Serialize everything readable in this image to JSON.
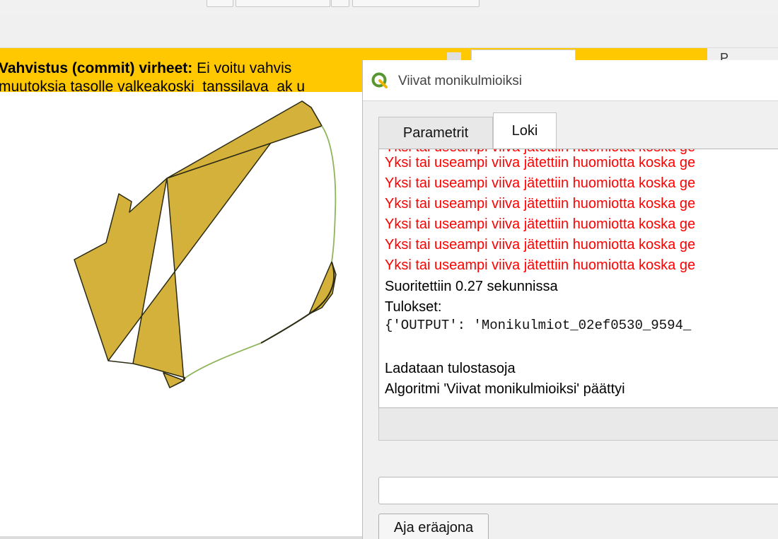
{
  "message_bar": {
    "title": "Vahvistus (commit) virheet:",
    "text": " Ei voitu vahvis",
    "second_line": "muutoksia tasolle valkeakoski_tanssilava_ak u"
  },
  "right_panel": {
    "label": "P"
  },
  "dialog": {
    "title": "Viivat monikulmioiksi",
    "tabs": [
      {
        "label": "Parametrit",
        "active": false
      },
      {
        "label": "Loki",
        "active": true
      }
    ],
    "log": {
      "error_lines": [
        "Yksi tai useampi viiva jätettiin huomiotta koska ge",
        "Yksi tai useampi viiva jätettiin huomiotta koska ge",
        "Yksi tai useampi viiva jätettiin huomiotta koska ge",
        "Yksi tai useampi viiva jätettiin huomiotta koska ge",
        "Yksi tai useampi viiva jätettiin huomiotta koska ge",
        "Yksi tai useampi viiva jätettiin huomiotta koska ge"
      ],
      "clipped_line": "Yksi tai useampi viiva jätettiin huomiotta koska ge",
      "duration": "Suoritettiin 0.27 sekunnissa",
      "results_label": "Tulokset:",
      "results_value": "{'OUTPUT': 'Monikulmiot_02ef0530_9594_",
      "loading": "Ladataan tulostasoja",
      "finished": "Algoritmi 'Viivat monikulmioiksi' päättyi"
    },
    "run_batch_button": "Aja eräajona"
  },
  "colors": {
    "message_bar": "#ffc800",
    "polygon_fill": "#d4b13a",
    "polygon_stroke": "#2b2b14",
    "line_green": "#8fb55a",
    "error_text": "#ff0000",
    "qgis_green": "#589632"
  }
}
